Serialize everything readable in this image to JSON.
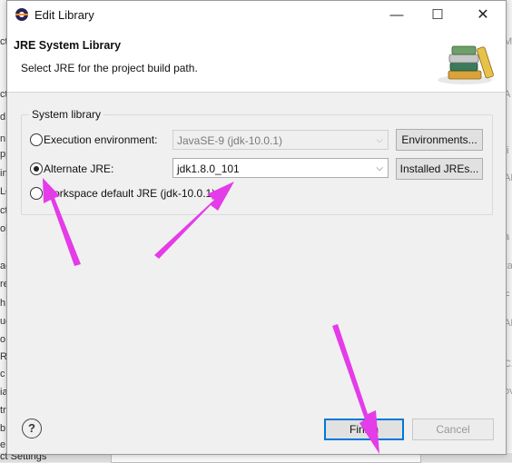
{
  "background": {
    "left_fragments": [
      "ct",
      "ct",
      "d",
      "n",
      "pp",
      "in",
      "Lo",
      "ct",
      "ol",
      "ac",
      "re",
      "h",
      "ue",
      "o",
      "R",
      "c",
      "ia",
      "tr",
      "b",
      "e"
    ],
    "right_fragments": [
      "M",
      "A",
      "ti",
      "AF",
      "a",
      "ra",
      "F",
      "AF",
      "CX",
      "ov"
    ],
    "bottom_fragment": "ct Settings"
  },
  "dialog": {
    "title": "Edit Library",
    "banner": {
      "title": "JRE System Library",
      "description": "Select JRE for the project build path."
    },
    "group_label": "System library",
    "options": {
      "execution_environment": {
        "label": "Execution environment:",
        "value": "JavaSE-9 (jdk-10.0.1)",
        "button": "Environments..."
      },
      "alternate_jre": {
        "label": "Alternate JRE:",
        "value": "jdk1.8.0_101",
        "button": "Installed JREs..."
      },
      "workspace_default": {
        "label": "Workspace default JRE (jdk-10.0.1)"
      }
    },
    "buttons": {
      "finish": "Finish",
      "cancel": "Cancel"
    }
  },
  "colors": {
    "annotation_arrows": "#e43ce8",
    "default_button_border": "#0078d7"
  }
}
